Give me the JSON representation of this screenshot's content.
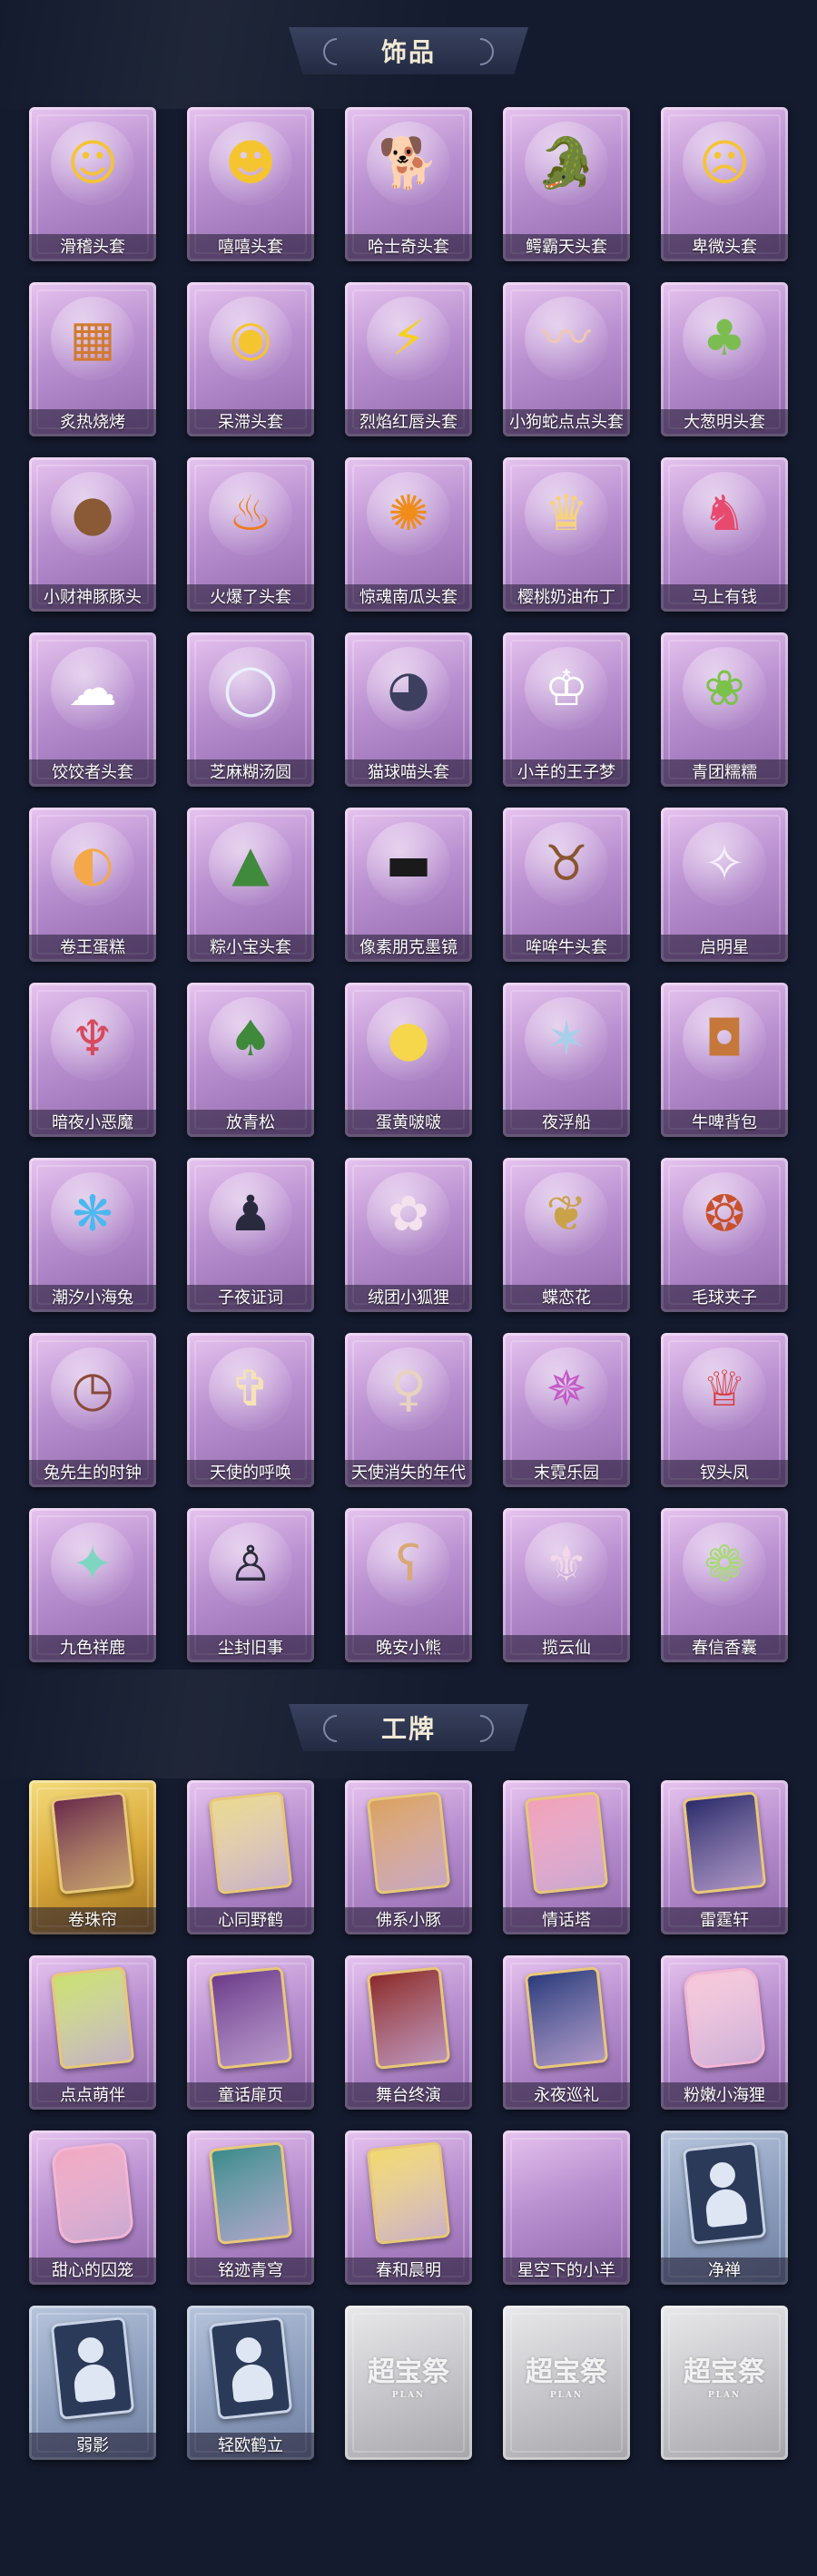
{
  "sections": {
    "accessories": {
      "title": "饰品",
      "items": [
        {
          "name": "滑稽头套",
          "icon": "grinning-face-icon",
          "glyph": "☺",
          "color": "#f5c431"
        },
        {
          "name": "嘻嘻头套",
          "icon": "grimace-face-icon",
          "glyph": "☻",
          "color": "#f5c431"
        },
        {
          "name": "哈士奇头套",
          "icon": "husky-dog-icon",
          "glyph": "🐕",
          "color": "#4a3b30"
        },
        {
          "name": "鳄霸天头套",
          "icon": "crocodile-icon",
          "glyph": "🐊",
          "color": "#3aa85a"
        },
        {
          "name": "卑微头套",
          "icon": "worried-face-icon",
          "glyph": "☹",
          "color": "#f5c431"
        },
        {
          "name": "炙热烧烤",
          "icon": "grill-toast-icon",
          "glyph": "▦",
          "color": "#d27a2e"
        },
        {
          "name": "呆滞头套",
          "icon": "blank-face-icon",
          "glyph": "◉",
          "color": "#f5c431"
        },
        {
          "name": "烈焰红唇头套",
          "icon": "electric-mouse-icon",
          "glyph": "⚡",
          "color": "#f5d020"
        },
        {
          "name": "小狗蛇点点头套",
          "icon": "snake-icon",
          "glyph": "〰",
          "color": "#f2c6b0"
        },
        {
          "name": "大葱明头套",
          "icon": "scallion-icon",
          "glyph": "♣",
          "color": "#7cbd52"
        },
        {
          "name": "小财神豚豚头",
          "icon": "pig-icon",
          "glyph": "●",
          "color": "#8a5a36"
        },
        {
          "name": "火爆了头套",
          "icon": "fire-icon",
          "glyph": "♨",
          "color": "#f07a18"
        },
        {
          "name": "惊魂南瓜头套",
          "icon": "pumpkin-icon",
          "glyph": "✺",
          "color": "#f08c1a"
        },
        {
          "name": "樱桃奶油布丁",
          "icon": "pudding-icon",
          "glyph": "♛",
          "color": "#f6d27e"
        },
        {
          "name": "马上有钱",
          "icon": "pink-horse-icon",
          "glyph": "♞",
          "color": "#e84a6e"
        },
        {
          "name": "饺饺者头套",
          "icon": "cloud-dumpling-icon",
          "glyph": "☁",
          "color": "#ffffff"
        },
        {
          "name": "芝麻糊汤圆",
          "icon": "rice-ball-icon",
          "glyph": "◯",
          "color": "#e8f2ff"
        },
        {
          "name": "猫球喵头套",
          "icon": "cat-ball-icon",
          "glyph": "◕",
          "color": "#3c3f5e"
        },
        {
          "name": "小羊的王子梦",
          "icon": "sheep-icon",
          "glyph": "♔",
          "color": "#ffffff"
        },
        {
          "name": "青团糯糯",
          "icon": "green-rice-cake-icon",
          "glyph": "❀",
          "color": "#7cc24a"
        },
        {
          "name": "卷王蛋糕",
          "icon": "cake-roll-icon",
          "glyph": "◐",
          "color": "#f4a84a"
        },
        {
          "name": "粽小宝头套",
          "icon": "zongzi-icon",
          "glyph": "▲",
          "color": "#3f8a3c"
        },
        {
          "name": "像素朋克墨镜",
          "icon": "pixel-sunglasses-icon",
          "glyph": "▬",
          "color": "#1a1a1a"
        },
        {
          "name": "哞哞牛头套",
          "icon": "cow-icon",
          "glyph": "♉",
          "color": "#8a5530"
        },
        {
          "name": "启明星",
          "icon": "starry-head-icon",
          "glyph": "✧",
          "color": "#f6f0ff"
        },
        {
          "name": "暗夜小恶魔",
          "icon": "devil-icon",
          "glyph": "♆",
          "color": "#d64a5c"
        },
        {
          "name": "放青松",
          "icon": "pine-bonsai-icon",
          "glyph": "♠",
          "color": "#3e8a3a"
        },
        {
          "name": "蛋黄啵啵",
          "icon": "chick-icon",
          "glyph": "●",
          "color": "#f6d64a"
        },
        {
          "name": "夜浮船",
          "icon": "crystal-ship-icon",
          "glyph": "✶",
          "color": "#a8cfe8"
        },
        {
          "name": "牛啤背包",
          "icon": "beer-backpack-icon",
          "glyph": "◘",
          "color": "#c6783a"
        },
        {
          "name": "潮汐小海兔",
          "icon": "sea-bunny-icon",
          "glyph": "❋",
          "color": "#4ab8f0"
        },
        {
          "name": "子夜证词",
          "icon": "raven-doll-icon",
          "glyph": "♟",
          "color": "#2a2a3e"
        },
        {
          "name": "绒团小狐狸",
          "icon": "fox-doll-icon",
          "glyph": "✿",
          "color": "#f4e2ee"
        },
        {
          "name": "蝶恋花",
          "icon": "butterfly-wreath-icon",
          "glyph": "❦",
          "color": "#c9a24a"
        },
        {
          "name": "毛球夹子",
          "icon": "red-panda-icon",
          "glyph": "❂",
          "color": "#c8502a"
        },
        {
          "name": "兔先生的时钟",
          "icon": "rabbit-clock-icon",
          "glyph": "◷",
          "color": "#8a4a3a"
        },
        {
          "name": "天使的呼唤",
          "icon": "angel-doll-icon",
          "glyph": "✞",
          "color": "#f6e2b6"
        },
        {
          "name": "天使消失的年代",
          "icon": "girl-doll-icon",
          "glyph": "♀",
          "color": "#e8d2c0"
        },
        {
          "name": "末霓乐园",
          "icon": "jester-doll-icon",
          "glyph": "✵",
          "color": "#c45ac8"
        },
        {
          "name": "钗头凤",
          "icon": "phoenix-crown-icon",
          "glyph": "♕",
          "color": "#d63a3a"
        },
        {
          "name": "九色祥鹿",
          "icon": "deer-icon",
          "glyph": "✦",
          "color": "#7ed6c0"
        },
        {
          "name": "尘封旧事",
          "icon": "boy-doll-icon",
          "glyph": "♙",
          "color": "#2a2a3a"
        },
        {
          "name": "晚安小熊",
          "icon": "bear-doll-icon",
          "glyph": "ʕ",
          "color": "#d8a878"
        },
        {
          "name": "揽云仙",
          "icon": "tassel-charm-icon",
          "glyph": "⚜",
          "color": "#f2d8e8"
        },
        {
          "name": "春信香囊",
          "icon": "sachet-icon",
          "glyph": "❁",
          "color": "#a8d87a"
        }
      ]
    },
    "badges": {
      "title": "工牌",
      "items": [
        {
          "name": "卷珠帘",
          "icon": "curtain-badge-icon",
          "style": "gold",
          "fill": "#6a2a4a"
        },
        {
          "name": "心同野鹤",
          "icon": "crane-badge-icon",
          "style": "purple",
          "fill": "#e8d890"
        },
        {
          "name": "佛系小豚",
          "icon": "piglet-badge-icon",
          "style": "purple",
          "fill": "#d8a060"
        },
        {
          "name": "情话塔",
          "icon": "tower-badge-icon",
          "style": "purple",
          "fill": "#f0a0b8"
        },
        {
          "name": "雷霆轩",
          "icon": "thunder-badge-icon",
          "style": "purple",
          "fill": "#2a2a6a"
        },
        {
          "name": "点点萌伴",
          "icon": "meadow-badge-icon",
          "style": "purple",
          "fill": "#c8e070"
        },
        {
          "name": "童话扉页",
          "icon": "fairytale-badge-icon",
          "style": "purple",
          "fill": "#6a3a8a"
        },
        {
          "name": "舞台终演",
          "icon": "stage-badge-icon",
          "style": "purple",
          "fill": "#8a2a2a"
        },
        {
          "name": "永夜巡礼",
          "icon": "night-badge-icon",
          "style": "purple",
          "fill": "#2a3a7a"
        },
        {
          "name": "粉嫩小海狸",
          "icon": "beaver-badge-icon",
          "style": "purple-pink",
          "fill": "#f6c8d8"
        },
        {
          "name": "甜心的囚笼",
          "icon": "cage-badge-icon",
          "style": "purple-pink",
          "fill": "#f0a8c0"
        },
        {
          "name": "铭迹青穹",
          "icon": "sky-badge-icon",
          "style": "purple",
          "fill": "#3a8a8a"
        },
        {
          "name": "春和晨明",
          "icon": "spring-badge-icon",
          "style": "purple",
          "fill": "#f0d870"
        },
        {
          "name": "星空下的小羊",
          "icon": "starry-sheep-badge-icon",
          "style": "purple-empty",
          "fill": "#c8a8d8"
        },
        {
          "name": "净禅",
          "icon": "silhouette-badge-icon",
          "style": "blue-silhouette",
          "fill": "#2c3a5a"
        },
        {
          "name": "弱影",
          "icon": "silhouette-badge-icon",
          "style": "blue-silhouette",
          "fill": "#2c3a5a"
        },
        {
          "name": "轻欧鹤立",
          "icon": "silhouette-badge-icon",
          "style": "blue-silhouette",
          "fill": "#2c3a5a"
        },
        {
          "name": "",
          "icon": "locked-badge-icon",
          "style": "grey-locked",
          "fill": "#d0d0d4"
        },
        {
          "name": "",
          "icon": "locked-badge-icon",
          "style": "grey-locked",
          "fill": "#d0d0d4"
        },
        {
          "name": "",
          "icon": "locked-badge-icon",
          "style": "grey-locked",
          "fill": "#d0d0d4"
        }
      ],
      "locked_watermark": "超宝祭",
      "locked_watermark_sub": "PLAN"
    }
  },
  "theme": {
    "background": "#141b2e",
    "title_text": "#f2ead6",
    "card_purple": "#b88fcf",
    "card_blue": "#8e9fbe",
    "card_gold": "#d9a93b",
    "card_grey": "#c8c8cc"
  }
}
